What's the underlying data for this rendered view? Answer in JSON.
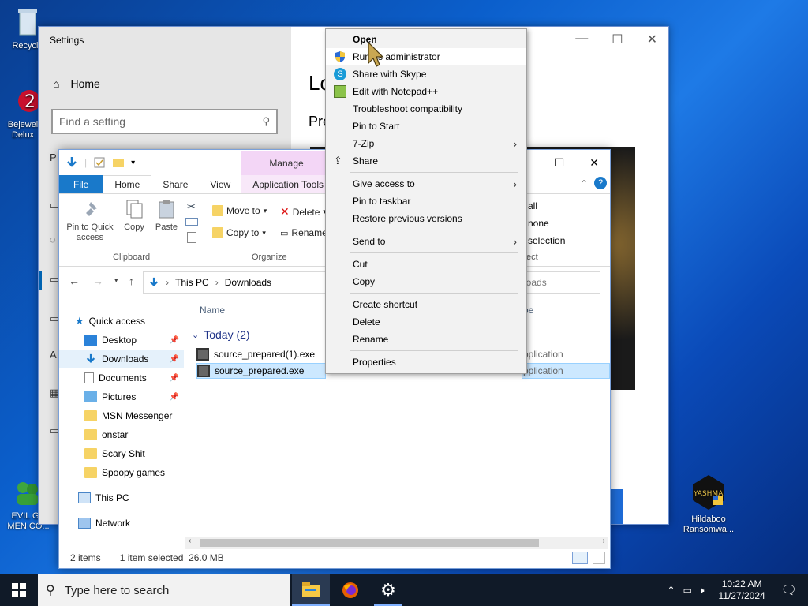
{
  "desktop": {
    "icons": [
      {
        "label": "Recycle"
      },
      {
        "label": "Bejewel Delux"
      },
      {
        "label": "EVIL GR MEN CO..."
      },
      {
        "label": "Hildaboo Ransomwa..."
      }
    ],
    "hildaboo_logo_text": "YASHMA"
  },
  "settings": {
    "title": "Settings",
    "home": "Home",
    "find_placeholder": "Find a setting",
    "right_title": "Lo",
    "right_sub": "Pre",
    "left_partial": "P",
    "left_partial2": "A"
  },
  "explorer": {
    "manage": "Manage",
    "tabs": [
      "File",
      "Home",
      "Share",
      "View",
      "Application Tools"
    ],
    "ribbon": {
      "pin": "Pin to Quick access",
      "copy": "Copy",
      "paste": "Paste",
      "clipboard": "Clipboard",
      "move_to": "Move to",
      "copy_to": "Copy to",
      "delete": "Delete",
      "rename": "Rename",
      "organize": "Organize",
      "select_all": "all",
      "select_none": "none",
      "invert": "selection",
      "select": "ect"
    },
    "address": {
      "this_pc": "This PC",
      "downloads": "Downloads"
    },
    "search_partial": "loads",
    "nav": {
      "quick_access": "Quick access",
      "items": [
        "Desktop",
        "Downloads",
        "Documents",
        "Pictures",
        "MSN Messenger",
        "onstar",
        "Scary Shit",
        "Spoopy games"
      ],
      "this_pc": "This PC",
      "network": "Network"
    },
    "columns": {
      "name": "Name",
      "type": "pe"
    },
    "group": "Today (2)",
    "files": [
      {
        "name": "source_prepared(1).exe",
        "type": "pplication"
      },
      {
        "name": "source_prepared.exe",
        "type": "pplication"
      }
    ],
    "status": {
      "count": "2 items",
      "selected": "1 item selected  26.0 MB"
    }
  },
  "context_menu": {
    "items": [
      {
        "label": "Open"
      },
      {
        "label": "Run as administrator"
      },
      {
        "label": "Share with Skype"
      },
      {
        "label": "Edit with Notepad++"
      },
      {
        "label": "Troubleshoot compatibility"
      },
      {
        "label": "Pin to Start"
      },
      {
        "label": "7-Zip"
      },
      {
        "label": "Share"
      },
      {
        "label": "Give access to"
      },
      {
        "label": "Pin to taskbar"
      },
      {
        "label": "Restore previous versions"
      },
      {
        "label": "Send to"
      },
      {
        "label": "Cut"
      },
      {
        "label": "Copy"
      },
      {
        "label": "Create shortcut"
      },
      {
        "label": "Delete"
      },
      {
        "label": "Rename"
      },
      {
        "label": "Properties"
      }
    ]
  },
  "taskbar": {
    "search_placeholder": "Type here to search",
    "time": "10:22 AM",
    "date": "11/27/2024"
  }
}
